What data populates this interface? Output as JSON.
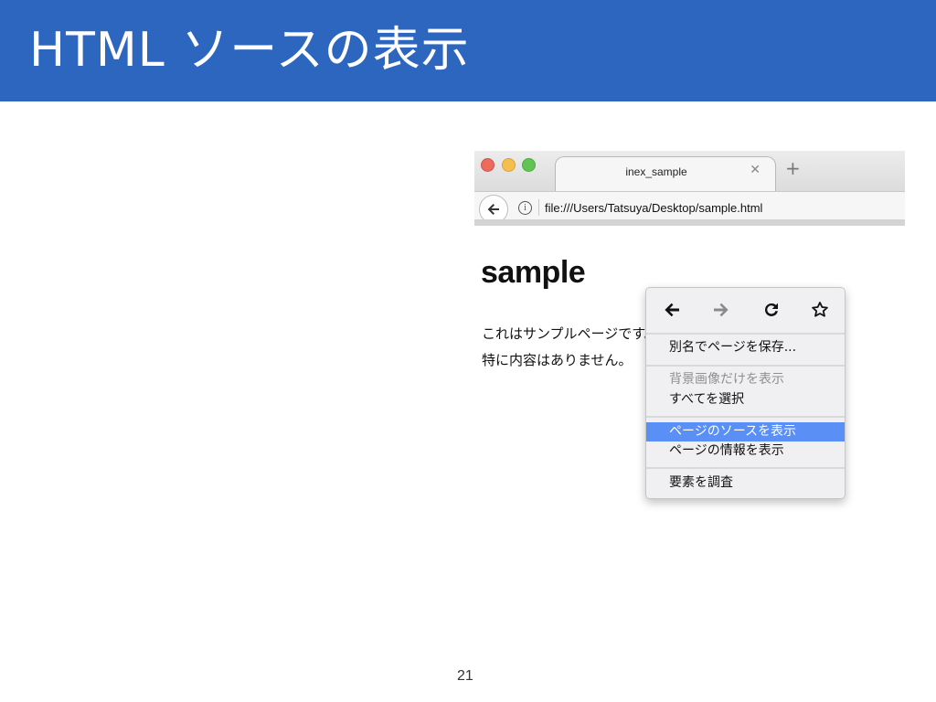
{
  "slide": {
    "title": "HTML ソースの表示",
    "page_number": "21",
    "title_bar_color": "#2d66be"
  },
  "browser": {
    "tab_title": "inex_sample",
    "tab_close_icon": "close-icon",
    "new_tab_icon": "plus-icon",
    "back_icon": "back-arrow-icon",
    "info_icon": "info-icon",
    "info_glyph": "i",
    "url": "file:///Users/Tatsuya/Desktop/sample.html"
  },
  "page": {
    "heading": "sample",
    "line1": "これはサンプルページです。",
    "line2": "特に内容はありません。"
  },
  "context_menu": {
    "nav_icons": [
      "back-arrow-icon",
      "forward-arrow-icon",
      "reload-icon",
      "bookmark-star-icon"
    ],
    "items": [
      {
        "label": "別名でページを保存...",
        "enabled": true
      },
      {
        "label": "背景画像だけを表示",
        "enabled": false
      },
      {
        "label": "すべてを選択",
        "enabled": true
      },
      {
        "label": "ページのソースを表示",
        "enabled": true,
        "highlighted": true
      },
      {
        "label": "ページの情報を表示",
        "enabled": true
      },
      {
        "label": "要素を調査",
        "enabled": true
      }
    ],
    "highlight_color": "#5a8ff5"
  }
}
